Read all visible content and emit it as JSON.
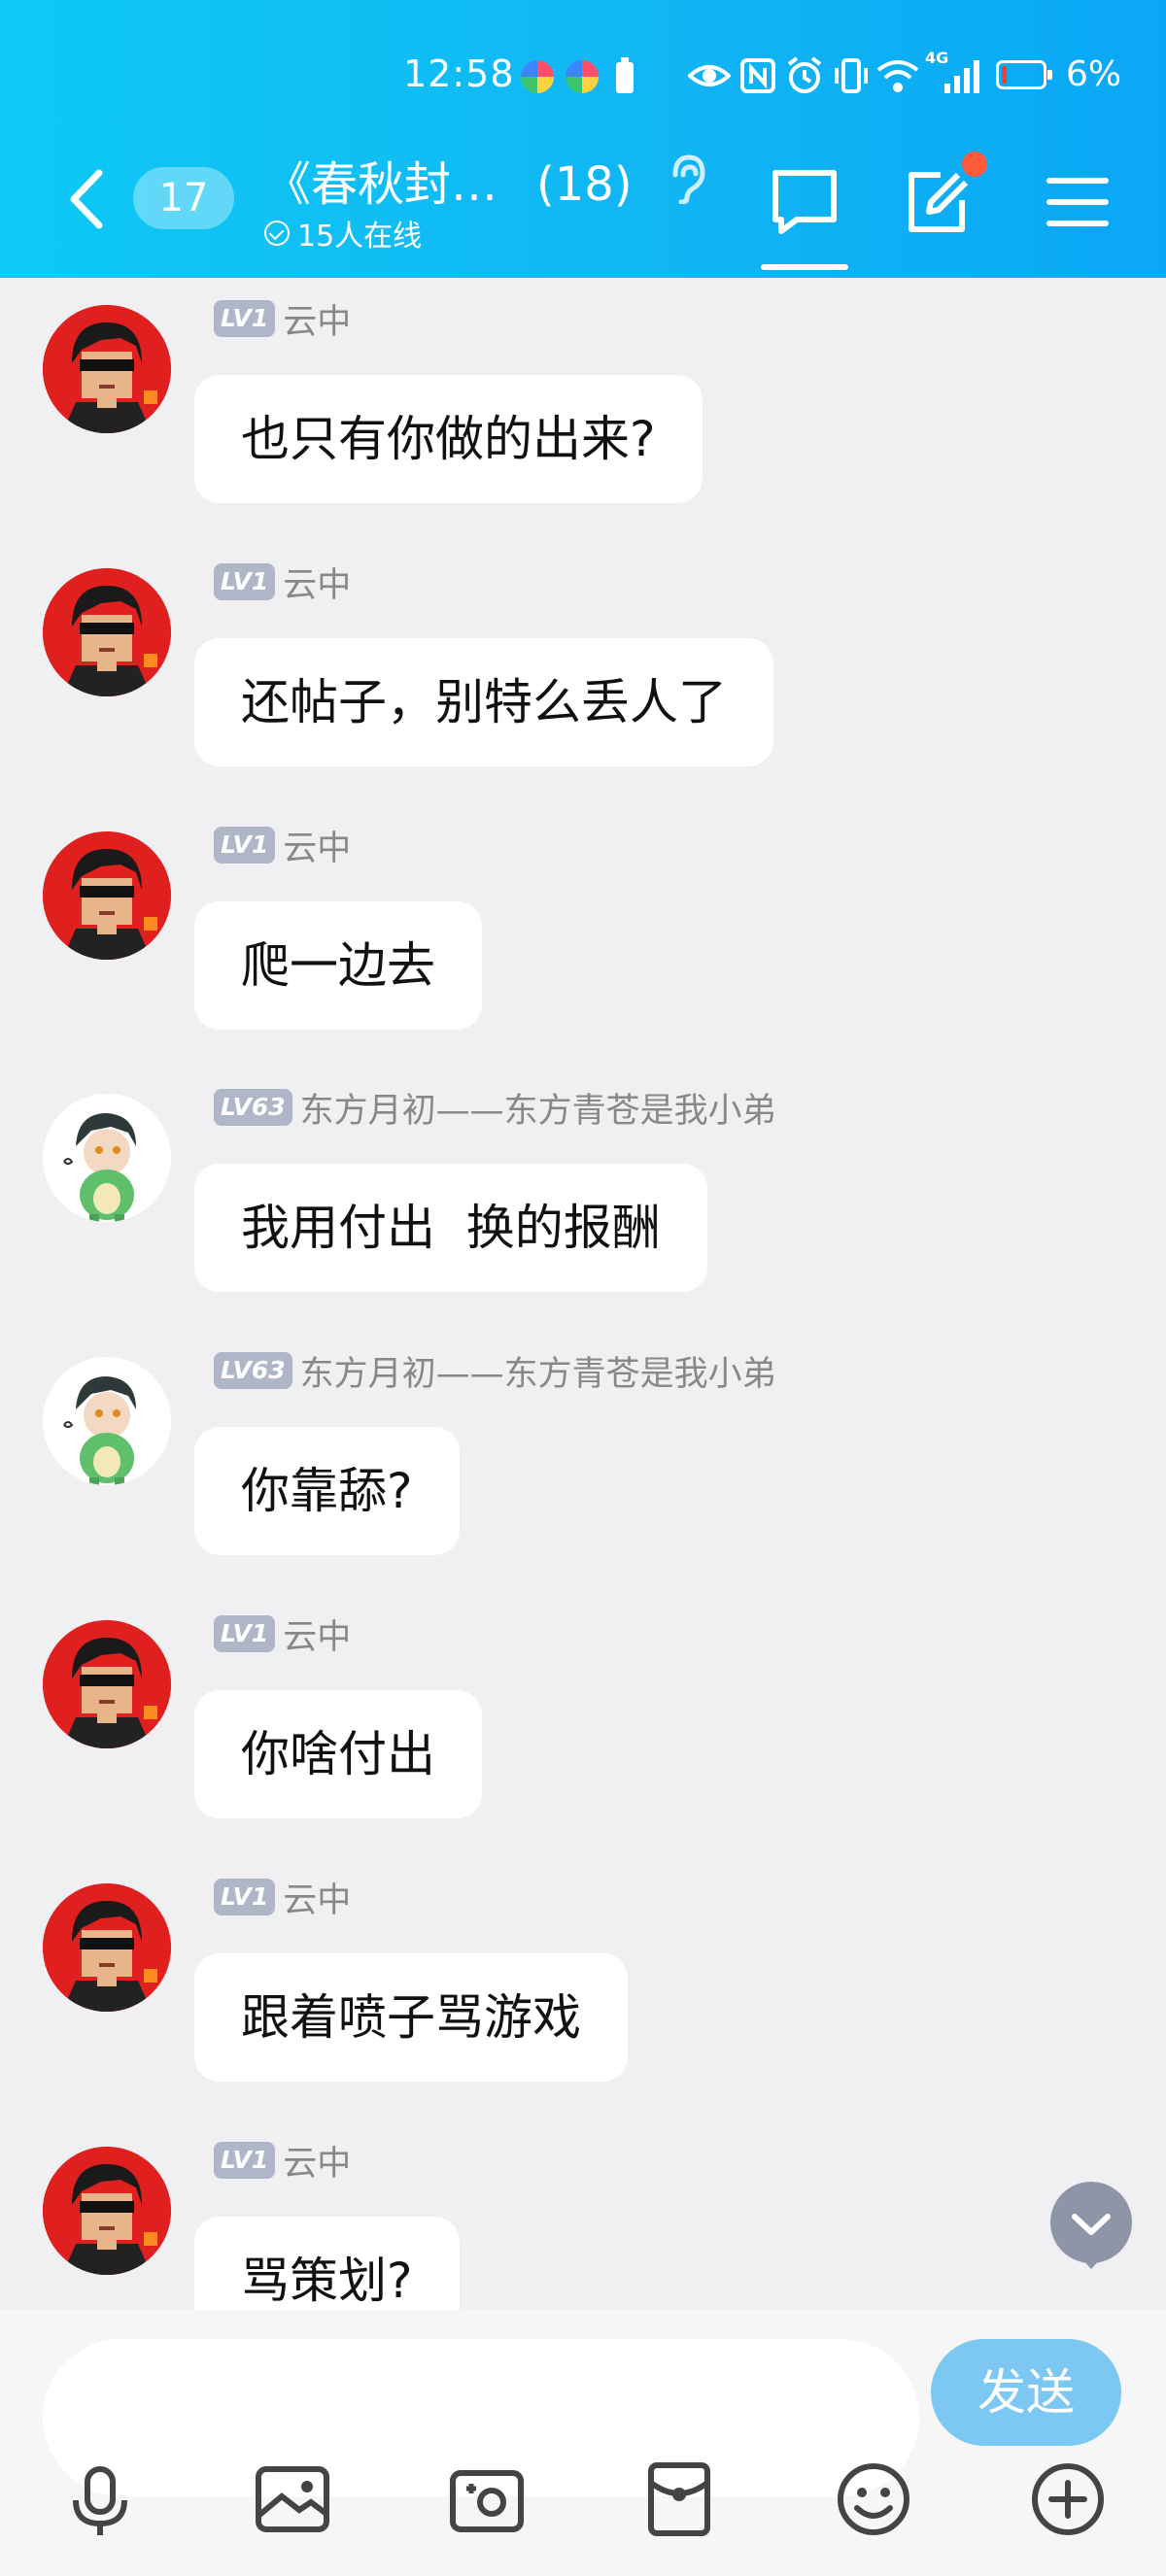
{
  "status_bar": {
    "time": "12:58",
    "network": "4G",
    "battery_percent": "6%"
  },
  "header": {
    "unread_count": "17",
    "group_name": "《春秋封…",
    "member_count": "(18)",
    "online": "15人在线"
  },
  "messages": [
    {
      "level": "LV1",
      "name": "云中",
      "text": "也只有你做的出来?",
      "avatar": "sunglasses-avatar"
    },
    {
      "level": "LV1",
      "name": "云中",
      "text": "还帖子，别特么丢人了",
      "avatar": "sunglasses-avatar"
    },
    {
      "level": "LV1",
      "name": "云中",
      "text": "爬一边去",
      "avatar": "sunglasses-avatar"
    },
    {
      "level": "LV63",
      "name": "东方月初——东方青苍是我小弟",
      "text": "我用付出  换的报酬",
      "avatar": "dinosaur-costume-avatar"
    },
    {
      "level": "LV63",
      "name": "东方月初——东方青苍是我小弟",
      "text": "你靠舔?",
      "avatar": "dinosaur-costume-avatar"
    },
    {
      "level": "LV1",
      "name": "云中",
      "text": "你啥付出",
      "avatar": "sunglasses-avatar"
    },
    {
      "level": "LV1",
      "name": "云中",
      "text": "跟着喷子骂游戏",
      "avatar": "sunglasses-avatar"
    },
    {
      "level": "LV1",
      "name": "云中",
      "text": "骂策划?",
      "avatar": "sunglasses-avatar"
    }
  ],
  "composer": {
    "placeholder": "",
    "send_label": "发送"
  },
  "toolbar_icons": [
    "microphone-icon",
    "image-icon",
    "camera-icon",
    "red-packet-icon",
    "emoji-icon",
    "plus-icon"
  ],
  "colors": {
    "header_start": "#0ec9f5",
    "header_end": "#0aa7f5",
    "level_badge": "#aeb6c8",
    "send_button": "#7cc8f3",
    "notification_dot": "#ff5a3c"
  }
}
